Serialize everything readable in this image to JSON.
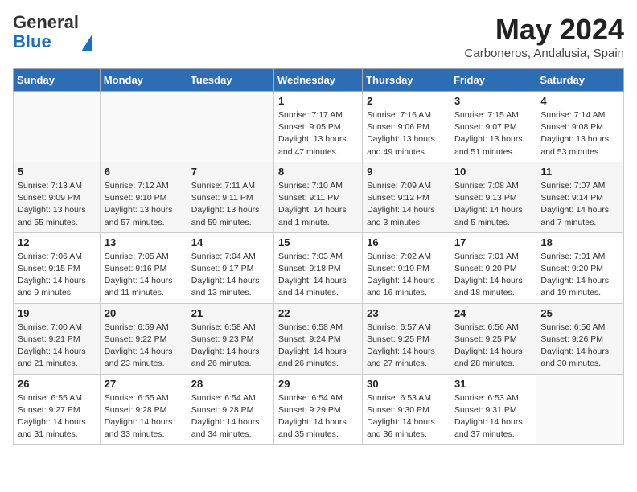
{
  "header": {
    "logo_line1": "General",
    "logo_line2": "Blue",
    "month_title": "May 2024",
    "location": "Carboneros, Andalusia, Spain"
  },
  "weekdays": [
    "Sunday",
    "Monday",
    "Tuesday",
    "Wednesday",
    "Thursday",
    "Friday",
    "Saturday"
  ],
  "weeks": [
    [
      {
        "day": "",
        "info": ""
      },
      {
        "day": "",
        "info": ""
      },
      {
        "day": "",
        "info": ""
      },
      {
        "day": "1",
        "info": "Sunrise: 7:17 AM\nSunset: 9:05 PM\nDaylight: 13 hours and 47 minutes."
      },
      {
        "day": "2",
        "info": "Sunrise: 7:16 AM\nSunset: 9:06 PM\nDaylight: 13 hours and 49 minutes."
      },
      {
        "day": "3",
        "info": "Sunrise: 7:15 AM\nSunset: 9:07 PM\nDaylight: 13 hours and 51 minutes."
      },
      {
        "day": "4",
        "info": "Sunrise: 7:14 AM\nSunset: 9:08 PM\nDaylight: 13 hours and 53 minutes."
      }
    ],
    [
      {
        "day": "5",
        "info": "Sunrise: 7:13 AM\nSunset: 9:09 PM\nDaylight: 13 hours and 55 minutes."
      },
      {
        "day": "6",
        "info": "Sunrise: 7:12 AM\nSunset: 9:10 PM\nDaylight: 13 hours and 57 minutes."
      },
      {
        "day": "7",
        "info": "Sunrise: 7:11 AM\nSunset: 9:11 PM\nDaylight: 13 hours and 59 minutes."
      },
      {
        "day": "8",
        "info": "Sunrise: 7:10 AM\nSunset: 9:11 PM\nDaylight: 14 hours and 1 minute."
      },
      {
        "day": "9",
        "info": "Sunrise: 7:09 AM\nSunset: 9:12 PM\nDaylight: 14 hours and 3 minutes."
      },
      {
        "day": "10",
        "info": "Sunrise: 7:08 AM\nSunset: 9:13 PM\nDaylight: 14 hours and 5 minutes."
      },
      {
        "day": "11",
        "info": "Sunrise: 7:07 AM\nSunset: 9:14 PM\nDaylight: 14 hours and 7 minutes."
      }
    ],
    [
      {
        "day": "12",
        "info": "Sunrise: 7:06 AM\nSunset: 9:15 PM\nDaylight: 14 hours and 9 minutes."
      },
      {
        "day": "13",
        "info": "Sunrise: 7:05 AM\nSunset: 9:16 PM\nDaylight: 14 hours and 11 minutes."
      },
      {
        "day": "14",
        "info": "Sunrise: 7:04 AM\nSunset: 9:17 PM\nDaylight: 14 hours and 13 minutes."
      },
      {
        "day": "15",
        "info": "Sunrise: 7:03 AM\nSunset: 9:18 PM\nDaylight: 14 hours and 14 minutes."
      },
      {
        "day": "16",
        "info": "Sunrise: 7:02 AM\nSunset: 9:19 PM\nDaylight: 14 hours and 16 minutes."
      },
      {
        "day": "17",
        "info": "Sunrise: 7:01 AM\nSunset: 9:20 PM\nDaylight: 14 hours and 18 minutes."
      },
      {
        "day": "18",
        "info": "Sunrise: 7:01 AM\nSunset: 9:20 PM\nDaylight: 14 hours and 19 minutes."
      }
    ],
    [
      {
        "day": "19",
        "info": "Sunrise: 7:00 AM\nSunset: 9:21 PM\nDaylight: 14 hours and 21 minutes."
      },
      {
        "day": "20",
        "info": "Sunrise: 6:59 AM\nSunset: 9:22 PM\nDaylight: 14 hours and 23 minutes."
      },
      {
        "day": "21",
        "info": "Sunrise: 6:58 AM\nSunset: 9:23 PM\nDaylight: 14 hours and 26 minutes."
      },
      {
        "day": "22",
        "info": "Sunrise: 6:58 AM\nSunset: 9:24 PM\nDaylight: 14 hours and 26 minutes."
      },
      {
        "day": "23",
        "info": "Sunrise: 6:57 AM\nSunset: 9:25 PM\nDaylight: 14 hours and 27 minutes."
      },
      {
        "day": "24",
        "info": "Sunrise: 6:56 AM\nSunset: 9:25 PM\nDaylight: 14 hours and 28 minutes."
      },
      {
        "day": "25",
        "info": "Sunrise: 6:56 AM\nSunset: 9:26 PM\nDaylight: 14 hours and 30 minutes."
      }
    ],
    [
      {
        "day": "26",
        "info": "Sunrise: 6:55 AM\nSunset: 9:27 PM\nDaylight: 14 hours and 31 minutes."
      },
      {
        "day": "27",
        "info": "Sunrise: 6:55 AM\nSunset: 9:28 PM\nDaylight: 14 hours and 33 minutes."
      },
      {
        "day": "28",
        "info": "Sunrise: 6:54 AM\nSunset: 9:28 PM\nDaylight: 14 hours and 34 minutes."
      },
      {
        "day": "29",
        "info": "Sunrise: 6:54 AM\nSunset: 9:29 PM\nDaylight: 14 hours and 35 minutes."
      },
      {
        "day": "30",
        "info": "Sunrise: 6:53 AM\nSunset: 9:30 PM\nDaylight: 14 hours and 36 minutes."
      },
      {
        "day": "31",
        "info": "Sunrise: 6:53 AM\nSunset: 9:31 PM\nDaylight: 14 hours and 37 minutes."
      },
      {
        "day": "",
        "info": ""
      }
    ]
  ]
}
